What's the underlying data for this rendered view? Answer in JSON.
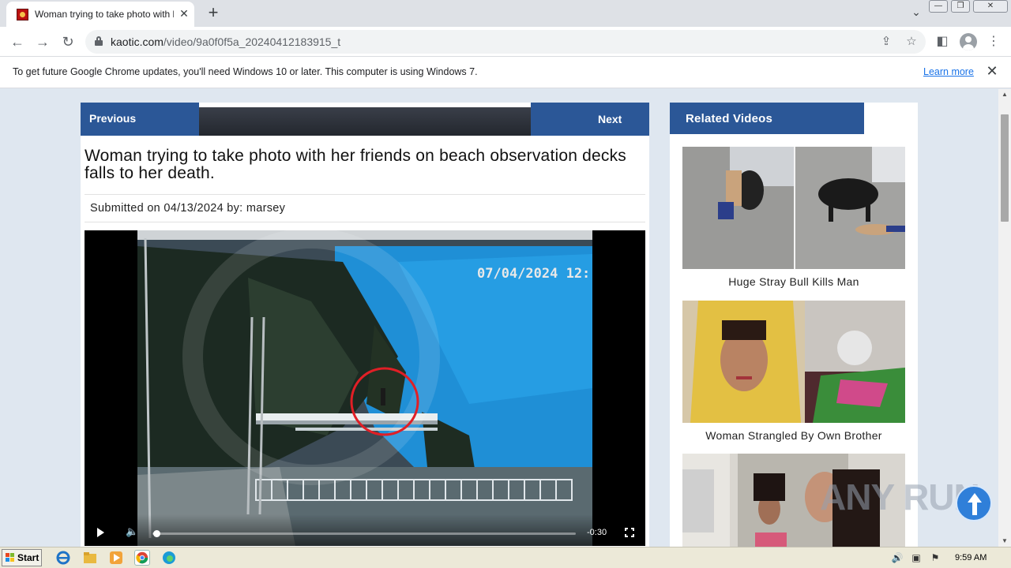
{
  "browser": {
    "tab_title": "Woman trying to take photo with her friends on beach observation decks falls to her death.",
    "tab_close": "✕",
    "new_tab": "+",
    "url_host": "kaotic.com",
    "url_path": "/video/9a0f0f5a_20240412183915_t",
    "window_min": "—",
    "window_max": "❐",
    "window_close": "✕"
  },
  "infobar": {
    "message": "To get future Google Chrome updates, you'll need Windows 10 or later. This computer is using Windows 7.",
    "learn_more": "Learn more",
    "close": "✕"
  },
  "page": {
    "prev_label": "Previous",
    "next_label": "Next",
    "title": "Woman trying to take photo with her friends on beach observation decks falls to her death.",
    "submitted_prefix": "Submitted on 04/13/2024 by: ",
    "submitted_user": "marsey",
    "video": {
      "timestamp": "07/04/2024 12:",
      "remaining": "-0:30",
      "progress": 0.01
    }
  },
  "related": {
    "header": "Related Videos",
    "items": [
      {
        "caption": "Huge Stray Bull Kills Man"
      },
      {
        "caption": "Woman Strangled By Own Brother"
      },
      {
        "caption": ""
      }
    ]
  },
  "watermark": "ANY RUN",
  "taskbar": {
    "start_label": "Start",
    "clock": "9:59 AM"
  },
  "icons": [
    "favicon-icon",
    "back-arrow-icon",
    "forward-arrow-icon",
    "reload-icon",
    "lock-icon",
    "share-icon",
    "star-icon",
    "side-panel-icon",
    "profile-icon",
    "menu-icon",
    "play-icon",
    "volume-icon",
    "fullscreen-icon"
  ]
}
